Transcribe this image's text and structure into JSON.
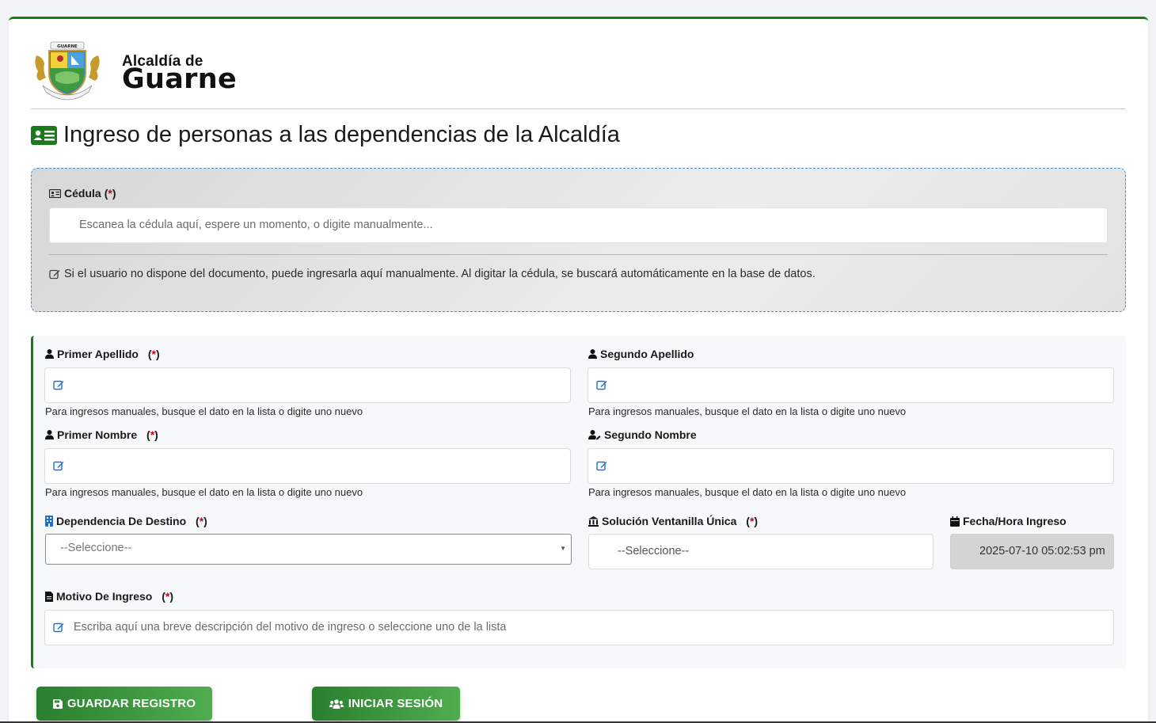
{
  "brand": {
    "seal_text_top": "GUARNE",
    "seal_text_bottom": "POR LABOR Y PROGRESO",
    "line1": "Alcaldía de",
    "line2": "Guarne"
  },
  "page": {
    "title": "Ingreso de personas a las dependencias de la Alcaldía"
  },
  "scan": {
    "label": "Cédula",
    "required_mark": "*",
    "placeholder": "Escanea la cédula aquí, espere un momento, o digite manualmente...",
    "note": "Si el usuario no dispone del documento, puede ingresarla aquí manualmente. Al digitar la cédula, se buscará automáticamente en la base de datos."
  },
  "form": {
    "help_text": "Para ingresos manuales, busque el dato en la lista o digite uno nuevo",
    "primer_apellido": {
      "label": "Primer Apellido",
      "required": true
    },
    "segundo_apellido": {
      "label": "Segundo Apellido",
      "required": false
    },
    "primer_nombre": {
      "label": "Primer Nombre",
      "required": true
    },
    "segundo_nombre": {
      "label": "Segundo Nombre",
      "required": false
    },
    "dependencia": {
      "label": "Dependencia De Destino",
      "value": "--Seleccione--"
    },
    "ventanilla": {
      "label": "Solución Ventanilla Única",
      "value": "--Seleccione--"
    },
    "fecha": {
      "label": "Fecha/Hora Ingreso",
      "value": "2025-07-10 05:02:53 pm"
    },
    "motivo": {
      "label": "Motivo De Ingreso",
      "placeholder": "Escriba aquí una breve descripción del motivo de ingreso o seleccione uno de la lista"
    }
  },
  "buttons": {
    "save": "GUARDAR REGISTRO",
    "login": "INICIAR SESIÓN"
  },
  "colors": {
    "accent_green": "#1b7a1e",
    "required_red": "#d0021b",
    "icon_blue": "#1f6fd1"
  },
  "icons": [
    "id-card-icon",
    "user-icon",
    "user-pen-icon",
    "building-icon",
    "bank-icon",
    "calendar-icon",
    "file-icon",
    "edit-icon",
    "save-icon",
    "users-icon"
  ]
}
